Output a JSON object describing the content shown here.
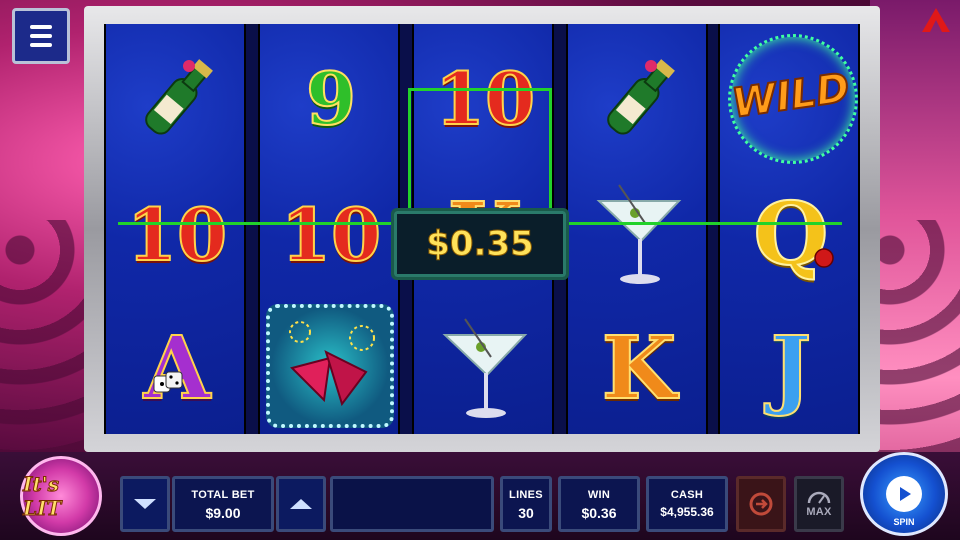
{
  "logo": {
    "text": "It's LIT"
  },
  "reels": [
    [
      "champagne-bottle",
      "10",
      "A"
    ],
    [
      "9",
      "10",
      "scatter-firework"
    ],
    [
      "10",
      "K",
      "martini"
    ],
    [
      "champagne-bottle",
      "martini",
      "K"
    ],
    [
      "WILD",
      "Q",
      "J"
    ]
  ],
  "win_popup": {
    "amount": "$0.35"
  },
  "controls": {
    "total_bet": {
      "label": "TOTAL BET",
      "value": "$9.00"
    },
    "lines": {
      "label": "LINES",
      "value": "30"
    },
    "win": {
      "label": "WIN",
      "value": "$0.36"
    },
    "cash": {
      "label": "CASH",
      "value": "$4,955.36"
    },
    "max_label": "MAX",
    "spin_label": "SPIN"
  },
  "colors": {
    "payline": "#22d22a",
    "win_text": "#ffe25a"
  }
}
